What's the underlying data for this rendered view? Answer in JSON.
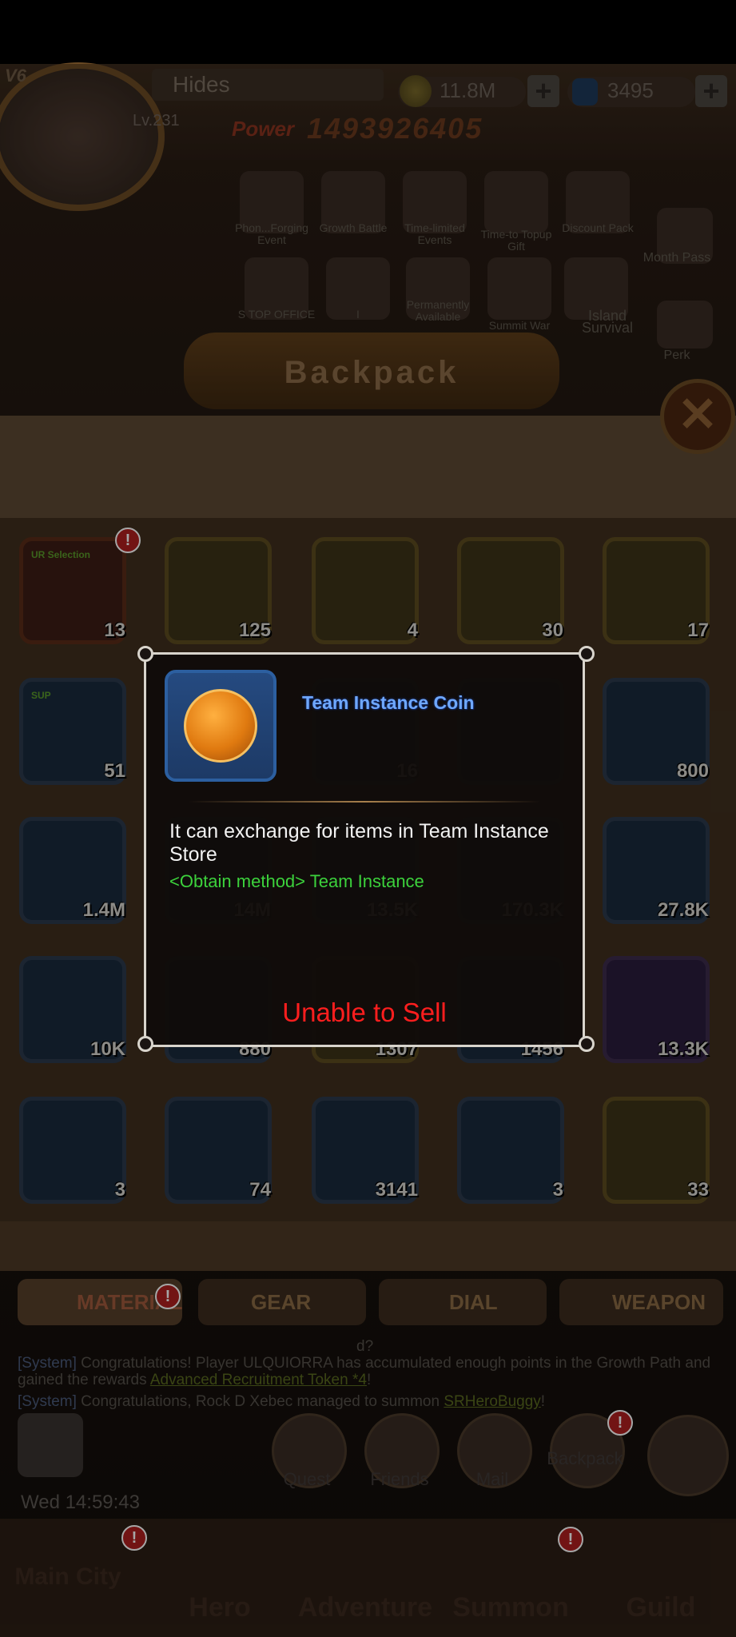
{
  "header": {
    "vip": "V6",
    "player_name": "Hides",
    "level": "Lv.231",
    "power_label": "Power",
    "power_value": "1493926405",
    "coins": "11.8M",
    "gems": "3495"
  },
  "events": [
    {
      "label": "Phon...Forging Event"
    },
    {
      "label": "Growth Battle"
    },
    {
      "label": "Time-limited Events"
    },
    {
      "label": "Time-to Topup Gift"
    },
    {
      "label": "Discount Pack"
    },
    {
      "label": "Month Pass"
    },
    {
      "label": "S TOP OFFICE"
    },
    {
      "label": "I"
    },
    {
      "label": "Permanently Available"
    },
    {
      "label": "Summit War"
    },
    {
      "label": "Island Survival"
    },
    {
      "label": "Perk"
    }
  ],
  "backpack": {
    "title": "Backpack",
    "rows": [
      [
        {
          "qty": "13",
          "style": "red",
          "badge": "!",
          "tag": "UR Selection"
        },
        {
          "qty": "125",
          "style": "gold"
        },
        {
          "qty": "4",
          "style": "gold"
        },
        {
          "qty": "30",
          "style": "gold"
        },
        {
          "qty": "17",
          "style": "gold"
        }
      ],
      [
        {
          "qty": "51",
          "style": "blue",
          "tag": "SUP"
        },
        {
          "qty": "",
          "style": "blue"
        },
        {
          "qty": "16",
          "style": "blue"
        },
        {
          "qty": "",
          "style": "blue"
        },
        {
          "qty": "800",
          "style": "blue"
        }
      ],
      [
        {
          "qty": "1.4M",
          "style": "blue"
        },
        {
          "qty": "14M",
          "style": "blue"
        },
        {
          "qty": "13.5K",
          "style": "blue"
        },
        {
          "qty": "170.3K",
          "style": "blue"
        },
        {
          "qty": "27.8K",
          "style": "blue"
        }
      ],
      [
        {
          "qty": "10K",
          "style": "blue"
        },
        {
          "qty": "880",
          "style": "blue"
        },
        {
          "qty": "1307",
          "style": "gold"
        },
        {
          "qty": "1456",
          "style": "blue"
        },
        {
          "qty": "13.3K",
          "style": "purple"
        }
      ],
      [
        {
          "qty": "3",
          "style": "blue"
        },
        {
          "qty": "74",
          "style": "blue"
        },
        {
          "qty": "3141",
          "style": "blue"
        },
        {
          "qty": "3",
          "style": "blue"
        },
        {
          "qty": "33",
          "style": "gold"
        }
      ]
    ]
  },
  "tabs": [
    {
      "label": "MATERIAL",
      "active": true
    },
    {
      "label": "GEAR"
    },
    {
      "label": "DIAL"
    },
    {
      "label": "WEAPON"
    }
  ],
  "chat": {
    "line0": "d?",
    "line1_sys": "[System]",
    "line1_text": " Congratulations! Player ULQUIORRA has accumulated enough points in the Growth Path and gained the rewards",
    "line1_link": "Advanced Recruitment Token *4",
    "line1_end": "!",
    "line2_sys": "[System]",
    "line2_text": " Congratulations, Rock D Xebec managed to summon",
    "line2_link": "SRHeroBuggy",
    "line2_end": "!"
  },
  "bottom_buttons": [
    {
      "label": "Quest"
    },
    {
      "label": "Friends"
    },
    {
      "label": "Mail"
    },
    {
      "label": "Backpack"
    }
  ],
  "time": "Wed 14:59:43",
  "bottom_nav": [
    {
      "label": "Main City"
    },
    {
      "label": "Hero"
    },
    {
      "label": "Adventure"
    },
    {
      "label": "Summon"
    },
    {
      "label": "Guild"
    }
  ],
  "popup": {
    "item_name": "Team Instance Coin",
    "description": "It can exchange for items in Team Instance Store",
    "obtain_method": "<Obtain method> Team Instance",
    "sell_status": "Unable to Sell"
  }
}
